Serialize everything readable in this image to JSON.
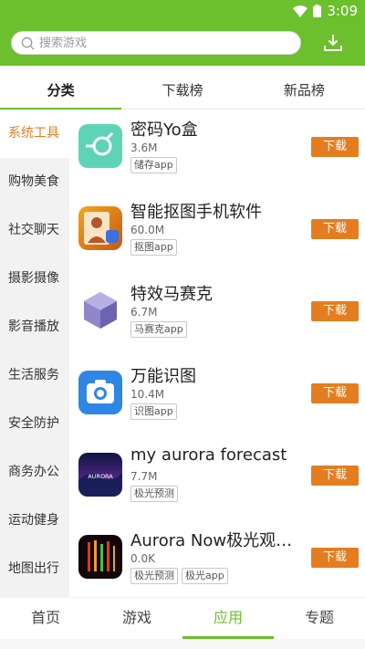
{
  "status": {
    "time": "3:09"
  },
  "search": {
    "placeholder": "搜索游戏"
  },
  "tabs": [
    {
      "label": "分类"
    },
    {
      "label": "下载榜"
    },
    {
      "label": "新品榜"
    }
  ],
  "categories": [
    {
      "label": "系统工具"
    },
    {
      "label": "购物美食"
    },
    {
      "label": "社交聊天"
    },
    {
      "label": "摄影摄像"
    },
    {
      "label": "影音播放"
    },
    {
      "label": "生活服务"
    },
    {
      "label": "安全防护"
    },
    {
      "label": "商务办公"
    },
    {
      "label": "运动健身"
    },
    {
      "label": "地图出行"
    }
  ],
  "apps": [
    {
      "name": "密码Yo盒",
      "size": "3.6M",
      "tags": [
        "储存app"
      ],
      "download": "下载",
      "icon": "password-box-icon"
    },
    {
      "name": "智能抠图手机软件",
      "size": "60.0M",
      "tags": [
        "抠图app"
      ],
      "download": "下载",
      "icon": "photo-cutout-icon"
    },
    {
      "name": "特效马赛克",
      "size": "6.7M",
      "tags": [
        "马赛克app"
      ],
      "download": "下载",
      "icon": "mosaic-cube-icon"
    },
    {
      "name": "万能识图",
      "size": "10.4M",
      "tags": [
        "识图app"
      ],
      "download": "下载",
      "icon": "camera-recognize-icon"
    },
    {
      "name": "my aurora forecast",
      "size": "7.7M",
      "tags": [
        "极光预测"
      ],
      "download": "下载",
      "icon": "aurora-icon",
      "icon_text": "AURORA"
    },
    {
      "name": "Aurora Now极光观测...",
      "size": "0.0K",
      "tags": [
        "极光预测",
        "极光app"
      ],
      "download": "下载",
      "icon": "aurora-now-icon"
    }
  ],
  "bottom_nav": [
    {
      "label": "首页"
    },
    {
      "label": "游戏"
    },
    {
      "label": "应用"
    },
    {
      "label": "专题"
    }
  ],
  "colors": {
    "brand_green": "#6cbf2d",
    "download_orange": "#e47d20"
  }
}
